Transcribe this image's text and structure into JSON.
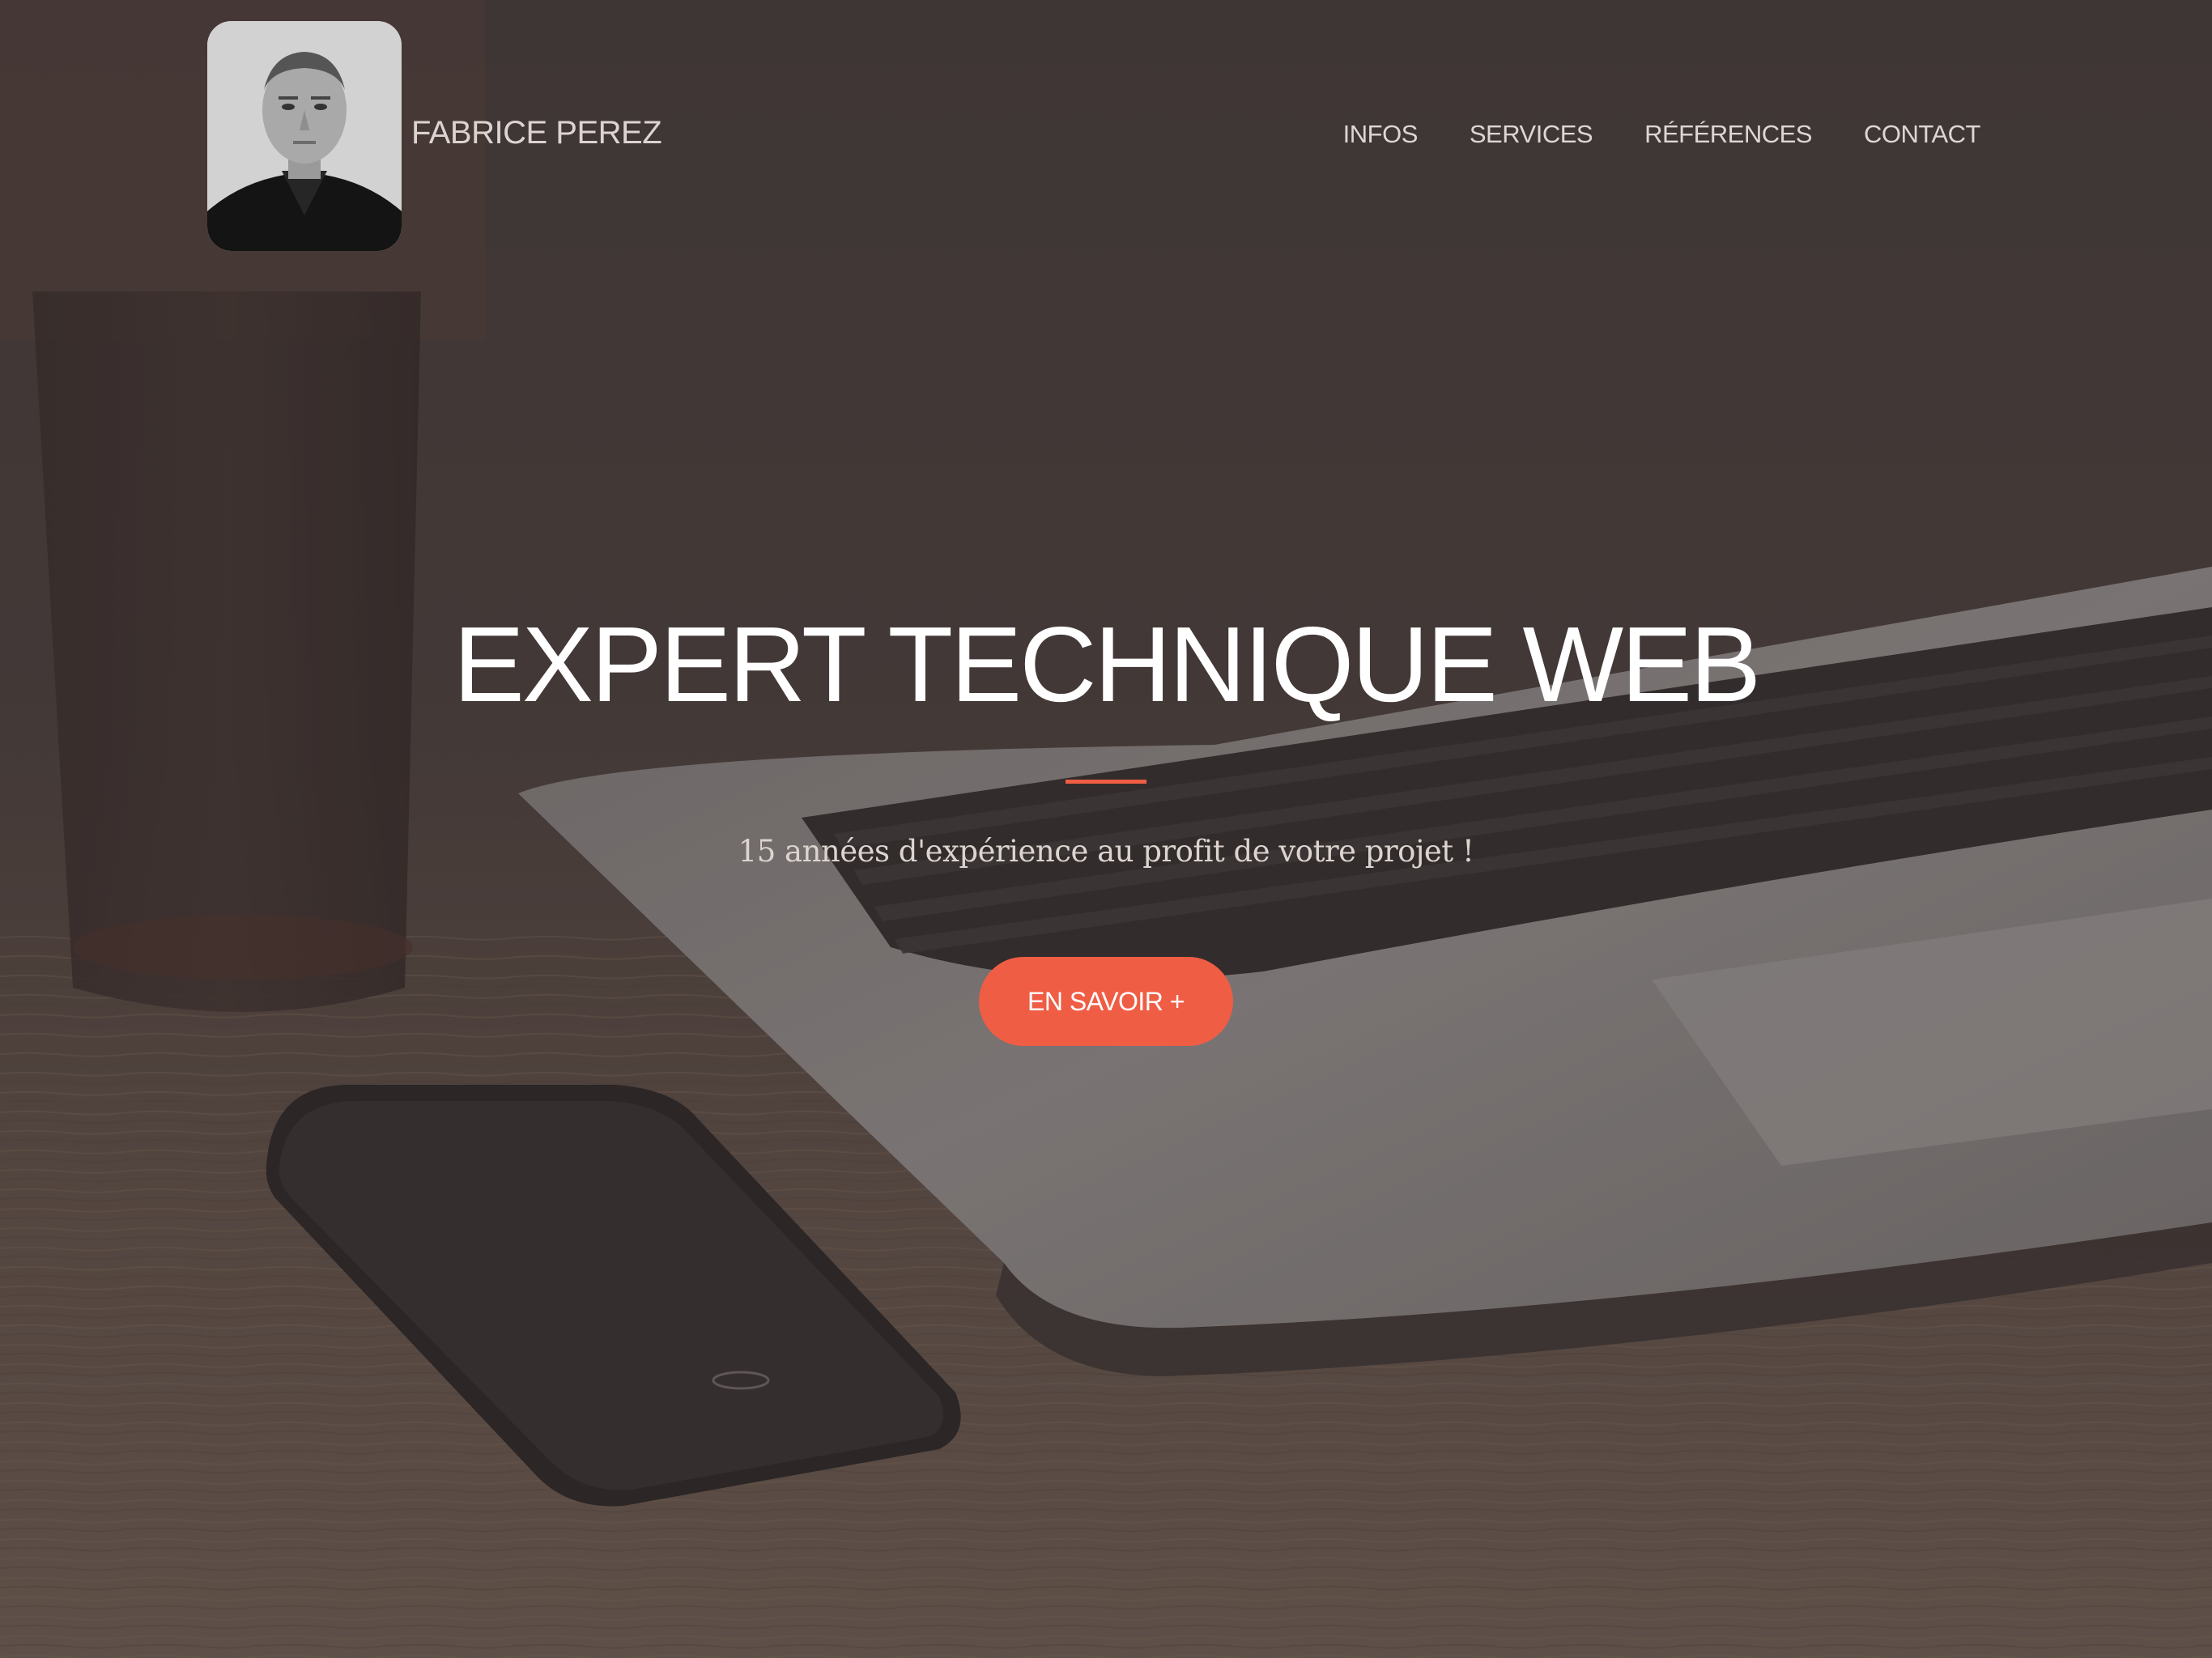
{
  "header": {
    "brand_name": "FABRICE PEREZ",
    "nav": [
      {
        "label": "INFOS"
      },
      {
        "label": "SERVICES"
      },
      {
        "label": "RÉFÉRENCES"
      },
      {
        "label": "CONTACT"
      }
    ]
  },
  "hero": {
    "title": "EXPERT TECHNIQUE WEB",
    "subtitle": "15 années d'expérience au profit de votre projet !",
    "cta_label": "EN SAVOIR +"
  },
  "colors": {
    "accent": "#ef5d45",
    "overlay": "#3f3938",
    "nav_text": "#ded6d4",
    "title_text": "#ffffff"
  }
}
